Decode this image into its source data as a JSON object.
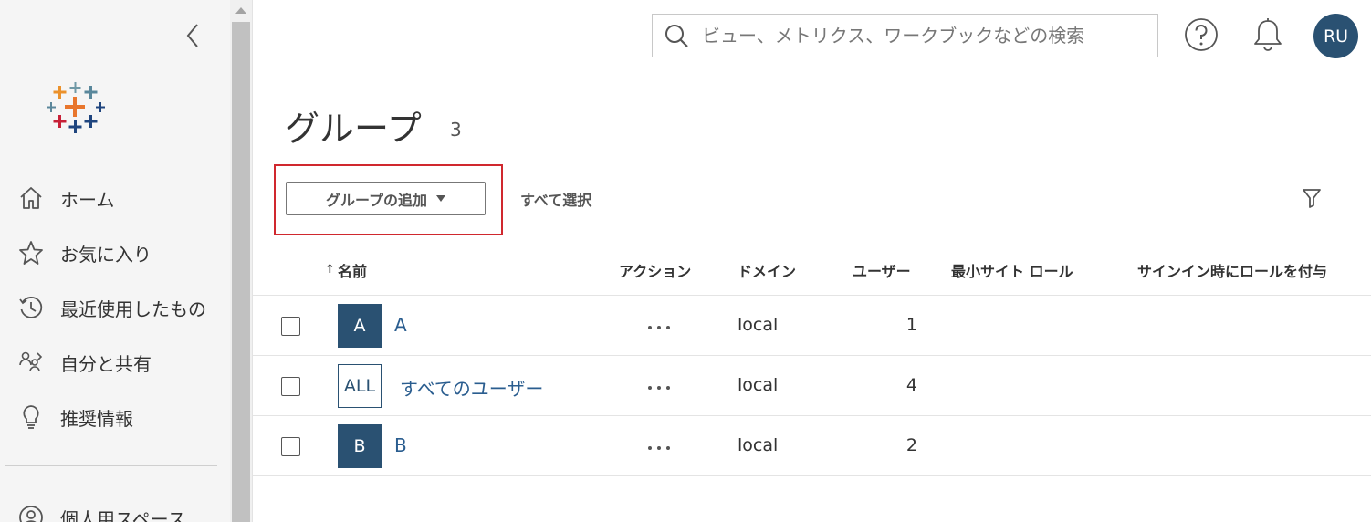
{
  "sidebar": {
    "collapse_icon": "chevron-left-icon",
    "logo": "tableau-logo",
    "items": [
      {
        "label": "ホーム",
        "icon": "home-icon"
      },
      {
        "label": "お気に入り",
        "icon": "star-icon"
      },
      {
        "label": "最近使用したもの",
        "icon": "history-icon"
      },
      {
        "label": "自分と共有",
        "icon": "shared-with-me-icon"
      },
      {
        "label": "推奨情報",
        "icon": "lightbulb-icon"
      },
      {
        "label": "個人用スペース",
        "icon": "user-circle-icon"
      }
    ]
  },
  "header": {
    "search_placeholder": "ビュー、メトリクス、ワークブックなどの検索",
    "avatar_initials": "RU"
  },
  "page": {
    "title": "グループ",
    "count": "3"
  },
  "toolbar": {
    "add_group_label": "グループの追加",
    "select_all_label": "すべて選択"
  },
  "table": {
    "columns": {
      "name": "名前",
      "actions": "アクション",
      "domain": "ドメイン",
      "users": "ユーザー",
      "min_site_role": "最小サイト ロール",
      "grant_role_on_signin": "サインイン時にロールを付与"
    },
    "sort_indicator": "↑",
    "rows": [
      {
        "avatar": "A",
        "name": "A",
        "domain": "local",
        "users": "1"
      },
      {
        "avatar": "ALL",
        "name": "すべてのユーザー",
        "domain": "local",
        "users": "4"
      },
      {
        "avatar": "B",
        "name": "B",
        "domain": "local",
        "users": "2"
      }
    ]
  },
  "colors": {
    "accent": "#2a5172",
    "link": "#2a5d8f",
    "highlight": "#d0282e"
  }
}
